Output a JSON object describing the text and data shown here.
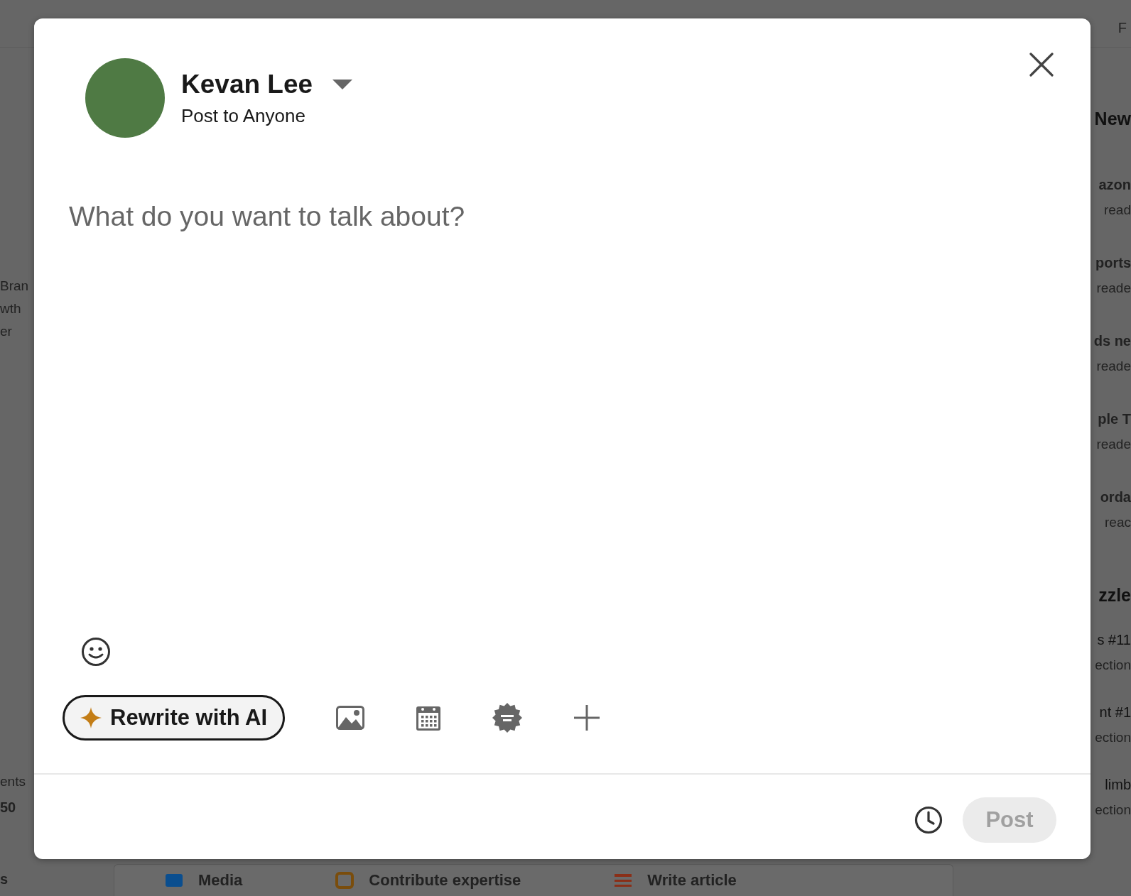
{
  "background": {
    "top_right": "F",
    "left": [
      "Bran",
      "wth",
      "er"
    ],
    "left_bottom": [
      {
        "kind": "text",
        "text": "ents"
      },
      {
        "kind": "bold",
        "text": "50"
      }
    ],
    "left_footer": "s",
    "right_title": "New",
    "right_items": [
      {
        "title": "azon",
        "sub": "read"
      },
      {
        "title": "ports",
        "sub": "reade"
      },
      {
        "title": "ds ne",
        "sub": "reade"
      },
      {
        "title": "ple T",
        "sub": "reade"
      },
      {
        "title": "orda",
        "sub": "reac"
      }
    ],
    "right_title_2": "zzle",
    "right_items_2": [
      {
        "title": "s #11",
        "sub": "ection"
      },
      {
        "title": "nt #1",
        "sub": "ection"
      },
      {
        "title": "limb",
        "sub": "ection"
      }
    ],
    "bottom_actions": [
      "Media",
      "Contribute expertise",
      "Write article"
    ]
  },
  "composer": {
    "author": "Kevan Lee",
    "audience": "Post to Anyone",
    "placeholder": "What do you want to talk about?",
    "ai_button": "Rewrite with AI",
    "post_button": {
      "label": "Post",
      "disabled": true
    }
  }
}
